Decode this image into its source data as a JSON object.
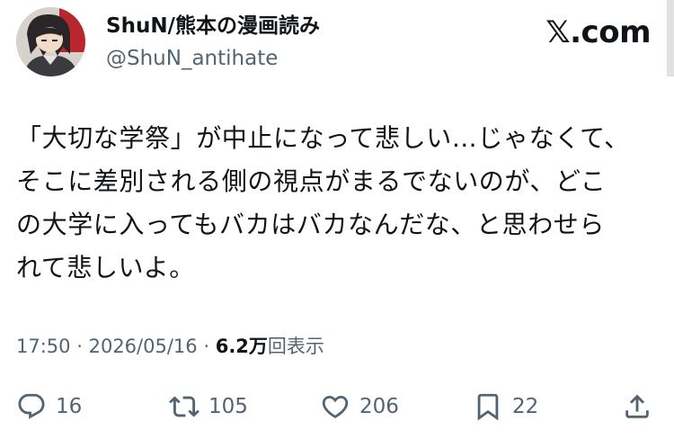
{
  "header": {
    "display_name": "ShuN/熊本の漫画読み",
    "handle": "@ShuN_antihate",
    "brand": "𝕏.com"
  },
  "tweet": {
    "lines": [
      "「大切な学祭」が中止になって悲しい…じゃなくて、",
      "そこに差別される側の視点がまるでないのが、どこ",
      "の大学に入ってもバカはバカなんだな、と思わせら",
      "れて悲しいよ。"
    ]
  },
  "meta": {
    "time": "17:50",
    "separator": "·",
    "date": "2026/05/16",
    "views_count": "6.2万",
    "views_label": "回表示"
  },
  "actions": {
    "replies": "16",
    "reposts": "105",
    "likes": "206",
    "bookmarks": "22"
  },
  "colors": {
    "text": "#0f1419",
    "secondary": "#536471",
    "background": "#ffffff"
  }
}
